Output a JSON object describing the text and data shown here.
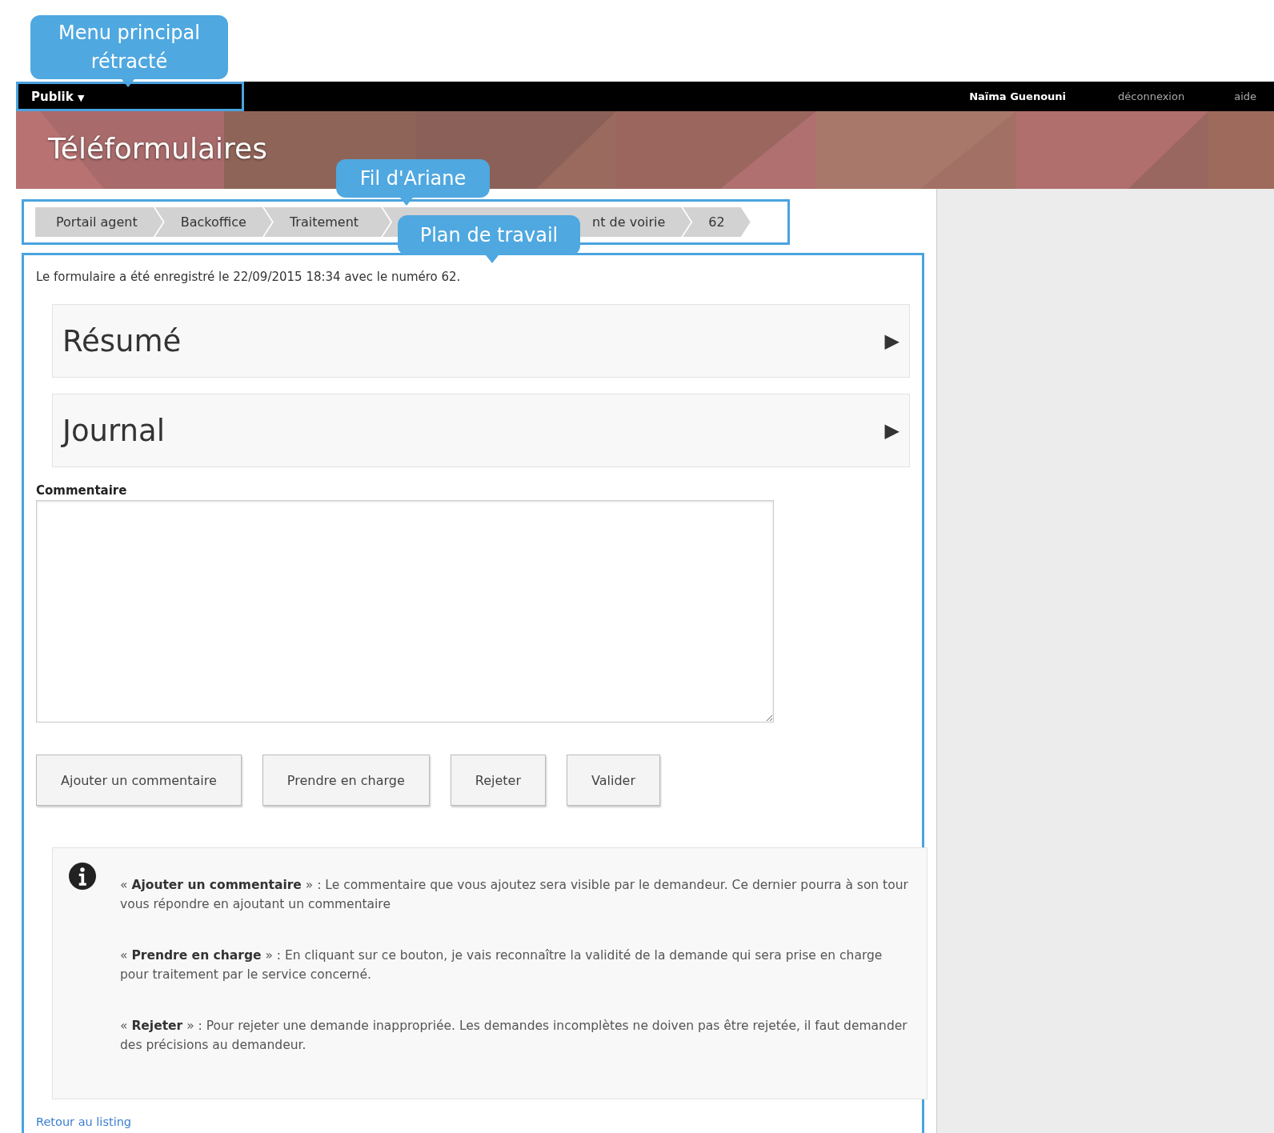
{
  "top_bar": {
    "brand": "Publik",
    "brand_caret": "▼",
    "user": "Naïma Guenouni",
    "links": [
      "déconnexion",
      "aide"
    ]
  },
  "banner": {
    "title": "Téléformulaires"
  },
  "breadcrumb": [
    "Portail agent",
    "Backoffice",
    "Traitement",
    "nt de voirie",
    "62"
  ],
  "main": {
    "notice": "Le formulaire a été enregistré le 22/09/2015 18:34 avec le numéro 62.",
    "sections": [
      {
        "title": "Résumé",
        "expanded": false,
        "toggle": "▶"
      },
      {
        "title": "Journal",
        "expanded": false,
        "toggle": "▶"
      }
    ],
    "comment": {
      "label": "Commentaire"
    },
    "buttons": [
      "Ajouter un commentaire",
      "Prendre en charge",
      "Rejeter",
      "Valider"
    ],
    "help": [
      "« **Ajouter un commentaire** » : Le commentaire que vous ajoutez sera visible par le demandeur. Ce dernier pourra à son tour vous répondre en ajoutant un commentaire",
      "« **Prendre en charge** » : En cliquant sur ce bouton, je vais reconnaître la validité de la demande qui sera prise en charge pour traitement par le service concerné.",
      "« **Rejeter** » : Pour rejeter une demande inappropriée. Les demandes incomplètes ne doiven pas être rejetée, il faut demander des précisions au demandeur."
    ],
    "back_link": "Retour au listing"
  },
  "annotations": [
    {
      "kind": "menu",
      "text": "Menu principal rétracté"
    },
    {
      "kind": "breadcrumb",
      "text": "Fil d'Ariane"
    },
    {
      "kind": "workspace",
      "text": "Plan de travail"
    }
  ]
}
